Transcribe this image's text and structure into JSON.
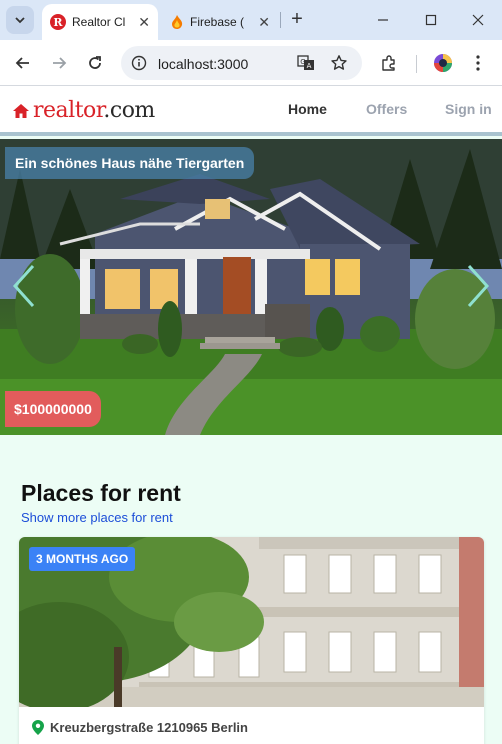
{
  "browser": {
    "tabs": [
      {
        "title": "Realtor Cl",
        "active": true
      },
      {
        "title": "Firebase (",
        "active": false
      }
    ],
    "url": "localhost:3000",
    "colors": {
      "chrome": "#dbe7f7",
      "omnibox": "#eef1f6"
    }
  },
  "site": {
    "logo": {
      "part1": "realtor",
      "part2": ".com"
    },
    "nav": [
      {
        "label": "Home",
        "active": true
      },
      {
        "label": "Offers",
        "active": false
      },
      {
        "label": "Sign in",
        "active": false
      }
    ],
    "colors": {
      "brand_red": "#d92228",
      "page_bg": "#ecfdf5",
      "link_blue": "#1d4ed8"
    }
  },
  "hero": {
    "title": "Ein schönes Haus nähe Tiergarten",
    "price": "$100000000"
  },
  "rent_section": {
    "title": "Places for rent",
    "link": "Show more places for rent",
    "listing": {
      "badge": "3 MONTHS AGO",
      "address": "Kreuzbergstraße 1210965 Berlin"
    }
  },
  "icons": [
    "tab-menu-icon",
    "realtor-favicon-icon",
    "firebase-favicon-icon",
    "close-icon",
    "new-tab-icon",
    "minimize-icon",
    "maximize-icon",
    "window-close-icon",
    "back-arrow-icon",
    "forward-arrow-icon",
    "reload-icon",
    "site-info-icon",
    "translate-icon",
    "star-icon",
    "extensions-icon",
    "profile-avatar-icon",
    "kebab-menu-icon",
    "house-logo-icon",
    "chevron-left-icon",
    "chevron-right-icon",
    "location-pin-icon"
  ]
}
